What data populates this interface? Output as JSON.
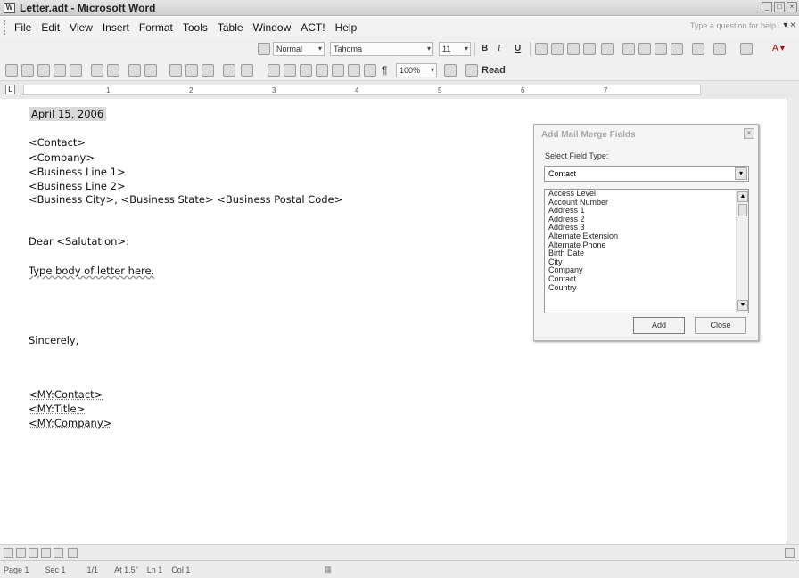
{
  "window": {
    "title": "Letter.adt - Microsoft Word",
    "controls": [
      "_",
      "□",
      "×"
    ]
  },
  "menu": {
    "items": [
      "File",
      "Edit",
      "View",
      "Insert",
      "Format",
      "Tools",
      "Table",
      "Window",
      "ACT!",
      "Help"
    ],
    "ask_placeholder": "Type a question for help"
  },
  "formatting": {
    "style": "Normal",
    "font": "Tahoma",
    "size": "11",
    "bold": "B",
    "italic": "I",
    "underline": "U"
  },
  "standard": {
    "zoom": "100%",
    "read_label": "Read"
  },
  "ruler": {
    "marks": [
      "1",
      "2",
      "3",
      "4",
      "5",
      "6",
      "7"
    ]
  },
  "document": {
    "date": "April 15, 2006",
    "contact": "<Contact>",
    "company": "<Company>",
    "business_line1": "<Business Line 1>",
    "business_line2": "<Business Line 2>",
    "city_state_zip": "<Business City>, <Business State> <Business Postal Code>",
    "greeting": "Dear <Salutation>:",
    "body": "Type body of letter here.",
    "closing": "Sincerely,",
    "sig_contact": "<MY:Contact>",
    "sig_title": "<MY:Title>",
    "sig_company": "<MY:Company>"
  },
  "dialog": {
    "title": "Add Mail Merge Fields",
    "select_label": "Select Field Type:",
    "selected": "Contact",
    "fields": [
      "Access Level",
      "Account Number",
      "Address 1",
      "Address 2",
      "Address 3",
      "Alternate Extension",
      "Alternate Phone",
      "Birth Date",
      "City",
      "Company",
      "Contact",
      "Country"
    ],
    "add_label": "Add",
    "close_label": "Close"
  },
  "status": {
    "page": "Page 1",
    "sec": "Sec 1",
    "page_of": "1/1",
    "at": "At 1.5\"",
    "ln": "Ln 1",
    "col": "Col 1"
  }
}
